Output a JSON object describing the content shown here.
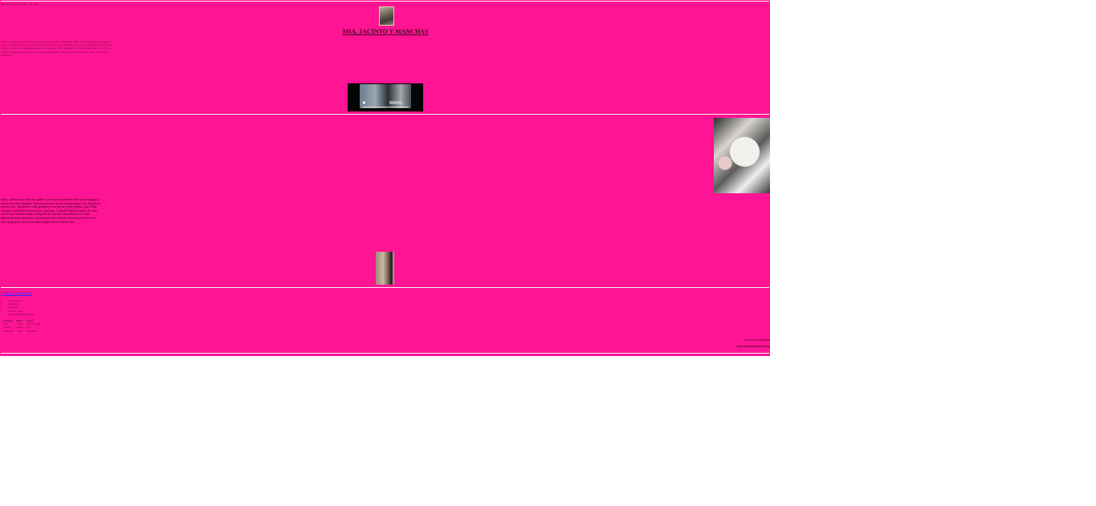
{
  "header": {
    "small_text": "Mia, Jacinto y Manchas - Mi blog",
    "title": "MIA, JACINTO Y MANCHAS"
  },
  "intro_text": "Esta es la historia de mis mascotas que se las que más te mostraré. Mia es una gatita adoptada que ha vivido conmigo desde hace años, luego llegaron Jacinto y Manchas que son sus compañeros de juegos. Aquí os cuento sus aventuras diarias, cómo juegan, cómo duermen y cómo comparten la casa. Es una familia pequeña pero muy feliz y espero que disfrutéis leyendo sobre ellos tanto como yo disfruto escribiendo.",
  "video": {
    "label": "video de los gatos"
  },
  "story_text": "Mia y Jacinto son mis dos gatos. Los dos empezaron de a poco a jugar y ahora son muy amigos. Duermen juntos en la misma cama y se limpian el uno al otro. Jacinto es más grande y a veces se pone celoso, pero Mia siempre encuentra la forma de calmarlo. Cuando llega la noche los dos corren por toda la casa y después se quedan dormidos en el sofá. Manchas llegó después y al principio tuvo miedo, pero poco a poco se unió al grupo y ahora los tres juegan juntos todo el día.",
  "links": {
    "main_link": "Enlaces a otras mascotas",
    "bullets": [
      "Los gatos de",
      "Mis perros",
      "Los peces",
      "Nuevas fotos",
      "Otros animales del blog"
    ]
  },
  "table": {
    "headers": [
      "Nombre",
      "Edad",
      "Color"
    ],
    "rows": [
      [
        "Mia",
        "3 años",
        "blanca y gris"
      ],
      [
        "Jacinto",
        "2 años",
        "gris"
      ],
      [
        "Manchas",
        "1 año",
        "manchado"
      ]
    ]
  },
  "footer": {
    "line1": "conoce a mis gatos",
    "line2": "www.miagatojacinto.blog"
  }
}
